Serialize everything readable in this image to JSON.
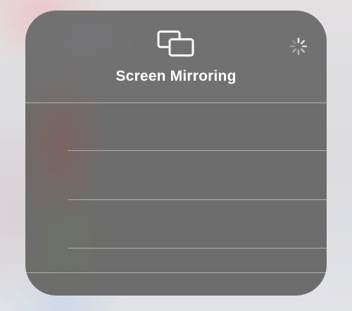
{
  "panel": {
    "title": "Screen Mirroring",
    "header_icon": "screen-mirroring-icon",
    "status_icon": "activity-spinner-icon",
    "device_rows": [
      {
        "label": ""
      },
      {
        "label": ""
      },
      {
        "label": ""
      }
    ]
  },
  "colors": {
    "panel_background": "#6d6d6d",
    "text": "#ffffff",
    "separator": "#bdbdbd"
  }
}
